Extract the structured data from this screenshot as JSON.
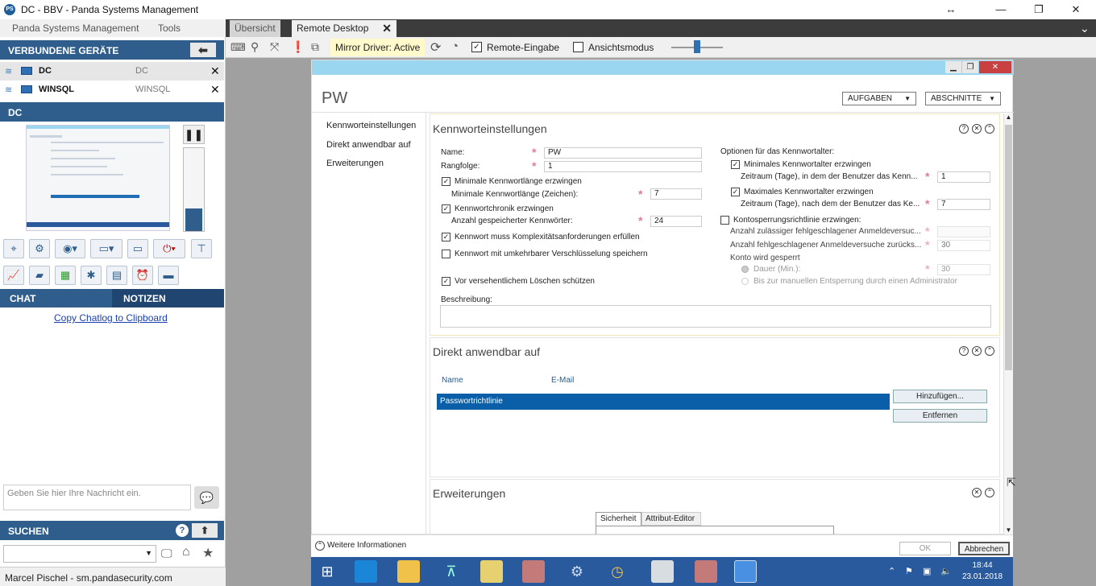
{
  "window": {
    "title": "DC - BBV - Panda Systems Management"
  },
  "menu": {
    "items": [
      "Panda Systems Management",
      "Tools"
    ]
  },
  "devices": {
    "header": "VERBUNDENE GERÄTE",
    "items": [
      {
        "name": "DC",
        "alias": "DC"
      },
      {
        "name": "WINSQL",
        "alias": "WINSQL"
      }
    ]
  },
  "current_device": {
    "name": "DC"
  },
  "chat": {
    "tab_chat": "CHAT",
    "tab_notes": "NOTIZEN",
    "copy_link": "Copy Chatlog to Clipboard",
    "input_placeholder": "Geben Sie hier Ihre Nachricht ein."
  },
  "search": {
    "header": "SUCHEN"
  },
  "status": {
    "user": "Marcel Pischel - sm.pandasecurity.com"
  },
  "tabs": {
    "overview": "Übersicht",
    "remote": "Remote Desktop"
  },
  "toolbar": {
    "mirror_driver": "Mirror Driver: Active",
    "remote_input": "Remote-Eingabe",
    "view_mode": "Ansichtsmodus"
  },
  "remote": {
    "title": "PW",
    "tasks_button": "AUFGABEN",
    "sections_button": "ABSCHNITTE",
    "nav": [
      "Kennworteinstellungen",
      "Direkt anwendbar auf",
      "Erweiterungen"
    ],
    "pwsettings": {
      "title": "Kennworteinstellungen",
      "name_label": "Name:",
      "name_value": "PW",
      "precedence_label": "Rangfolge:",
      "precedence_value": "1",
      "min_length_cb": "Minimale Kennwortlänge erzwingen",
      "min_length_label": "Minimale Kennwortlänge (Zeichen):",
      "min_length_value": "7",
      "history_cb": "Kennwortchronik erzwingen",
      "history_label": "Anzahl gespeicherter Kennwörter:",
      "history_value": "24",
      "complexity_cb": "Kennwort muss Komplexitätsanforderungen erfüllen",
      "reversible_cb": "Kennwort mit umkehrbarer Verschlüsselung speichern",
      "protect_cb": "Vor versehentlichem Löschen schützen",
      "description_label": "Beschreibung:",
      "age_options": "Optionen für das Kennwortalter:",
      "min_age_cb": "Minimales Kennwortalter erzwingen",
      "min_age_label": "Zeitraum (Tage), in dem der Benutzer das Kenn...",
      "min_age_value": "1",
      "max_age_cb": "Maximales Kennwortalter erzwingen",
      "max_age_label": "Zeitraum (Tage), nach dem der Benutzer das Ke...",
      "max_age_value": "7",
      "lockout_cb": "Kontosperrungsrichtlinie erzwingen:",
      "lockout_attempts_label": "Anzahl zulässiger fehlgeschlagener Anmeldeversuc...",
      "lockout_reset_label": "Anzahl fehlgeschlagener Anmeldeversuche zurücks...",
      "lockout_reset_value": "30",
      "locked_label": "Konto wird gesperrt",
      "duration_radio": "Dauer (Min.):",
      "duration_value": "30",
      "manual_radio": "Bis zur manuellen Entsperrung durch einen Administrator"
    },
    "applies": {
      "title": "Direkt anwendbar auf",
      "col_name": "Name",
      "col_email": "E-Mail",
      "row": "Passwortrichtlinie",
      "add_button": "Hinzufügen...",
      "remove_button": "Entfernen"
    },
    "extensions": {
      "title": "Erweiterungen",
      "tab_security": "Sicherheit",
      "tab_attr": "Attribut-Editor"
    },
    "more_info": "Weitere Informationen",
    "ok_button": "OK",
    "cancel_button": "Abbrechen",
    "clock_time": "18:44",
    "clock_date": "23.01.2018"
  }
}
